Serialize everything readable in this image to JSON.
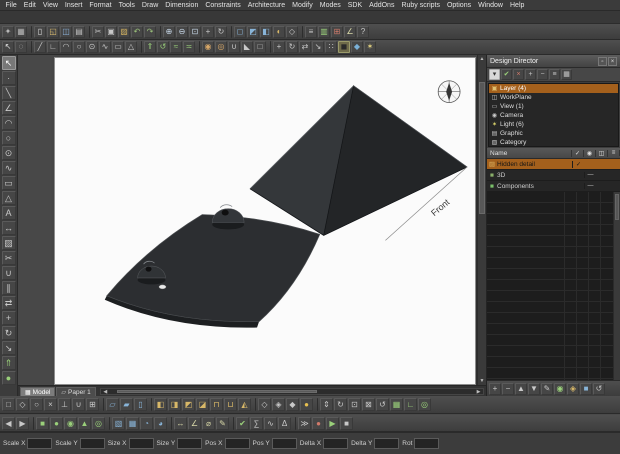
{
  "colors": {
    "selection_orange": "#a4601c",
    "paper_white": "#fbfbfb",
    "model_face_left": "#34373a",
    "model_face_right": "#232527",
    "model_plate": "#2c2e31",
    "model_edge_dark": "#1d1f21"
  },
  "icons": {
    "pin": "▫",
    "close": "×",
    "left_arrow": "◀",
    "right_arrow": "▶",
    "up_arrow": "▲",
    "down_arrow": "▼"
  },
  "menu": {
    "items": [
      "File",
      "Edit",
      "View",
      "Insert",
      "Format",
      "Tools",
      "Draw",
      "Dimension",
      "Constraints",
      "Architecture",
      "Modify",
      "Modes",
      "SDK",
      "AddOns",
      "Ruby scripts",
      "Options",
      "Window",
      "Help"
    ]
  },
  "toolbars": {
    "top1": [
      {
        "name": "settings-icon",
        "g": "✦",
        "c": "#b8b8b8"
      },
      {
        "name": "display-options-icon",
        "g": "▦",
        "c": "#b8b8b8"
      },
      {
        "name": "separator",
        "cls": "sep",
        "g": "",
        "interactable": false
      },
      {
        "name": "new-file-icon",
        "g": "▯",
        "c": "#e6e6e6"
      },
      {
        "name": "open-file-icon",
        "g": "◱",
        "c": "#e0c070"
      },
      {
        "name": "save-file-icon",
        "g": "◫",
        "c": "#8ab0d8"
      },
      {
        "name": "print-icon",
        "g": "▤",
        "c": "#c0c0c0"
      },
      {
        "name": "separator",
        "cls": "sep",
        "g": "",
        "interactable": false
      },
      {
        "name": "cut-icon",
        "g": "✂",
        "c": "#c8c8c8"
      },
      {
        "name": "copy-icon",
        "g": "▣",
        "c": "#c8c8c8"
      },
      {
        "name": "paste-icon",
        "g": "▨",
        "c": "#d0b060"
      },
      {
        "name": "undo-icon",
        "g": "↶",
        "c": "#9ac07a"
      },
      {
        "name": "redo-icon",
        "g": "↷",
        "c": "#9ac07a"
      },
      {
        "name": "separator",
        "cls": "sep",
        "g": "",
        "interactable": false
      },
      {
        "name": "zoom-in-icon",
        "g": "⊕",
        "c": "#c8d8e8"
      },
      {
        "name": "zoom-out-icon",
        "g": "⊖",
        "c": "#c8d8e8"
      },
      {
        "name": "zoom-fit-icon",
        "g": "⊡",
        "c": "#c8d8e8"
      },
      {
        "name": "pan-icon",
        "g": "+",
        "c": "#c8c8c8"
      },
      {
        "name": "rotate-view-icon",
        "g": "↻",
        "c": "#c8c8c8"
      },
      {
        "name": "separator",
        "cls": "sep",
        "g": "",
        "interactable": false
      },
      {
        "name": "front-view-icon",
        "g": "◻",
        "c": "#88b4d8"
      },
      {
        "name": "top-view-icon",
        "g": "◩",
        "c": "#88b4d8"
      },
      {
        "name": "iso-view-icon",
        "g": "◧",
        "c": "#88b4d8"
      },
      {
        "name": "shade-mode-icon",
        "g": "◐",
        "c": "#d8b868"
      },
      {
        "name": "wireframe-mode-icon",
        "g": "◇",
        "c": "#c8c8c8"
      },
      {
        "name": "separator",
        "cls": "sep",
        "g": "",
        "interactable": false
      },
      {
        "name": "layer-manager-icon",
        "g": "≡",
        "c": "#c8c8c8"
      },
      {
        "name": "design-director-icon",
        "g": "▥",
        "c": "#9ad07a"
      },
      {
        "name": "snap-grid-icon",
        "g": "⊞",
        "c": "#d07a6a"
      },
      {
        "name": "measure-icon",
        "g": "∠",
        "c": "#d8d8a8"
      },
      {
        "name": "help-icon",
        "g": "?",
        "c": "#c8c8c8"
      }
    ],
    "top2": [
      {
        "name": "select-icon",
        "g": "↖",
        "c": "#e8e8e8"
      },
      {
        "name": "lasso-select-icon",
        "g": "◌",
        "c": "#c8c8c8"
      },
      {
        "name": "separator",
        "cls": "sep",
        "g": "",
        "interactable": false
      },
      {
        "name": "line-tool-icon",
        "g": "╱",
        "c": "#c8c8c8"
      },
      {
        "name": "polyline-tool-icon",
        "g": "∟",
        "c": "#c8c8c8"
      },
      {
        "name": "arc-tool-icon",
        "g": "◠",
        "c": "#c8c8c8"
      },
      {
        "name": "circle-tool-icon",
        "g": "○",
        "c": "#c8c8c8"
      },
      {
        "name": "ellipse-tool-icon",
        "g": "⊙",
        "c": "#c8c8c8"
      },
      {
        "name": "spline-tool-icon",
        "g": "∿",
        "c": "#c8c8c8"
      },
      {
        "name": "rectangle-tool-icon",
        "g": "▭",
        "c": "#c8c8c8"
      },
      {
        "name": "polygon-tool-icon",
        "g": "△",
        "c": "#c8c8c8"
      },
      {
        "name": "separator",
        "cls": "sep",
        "g": "",
        "interactable": false
      },
      {
        "name": "extrude-icon",
        "g": "⇑",
        "c": "#9ad07a"
      },
      {
        "name": "revolve-icon",
        "g": "↺",
        "c": "#9ad07a"
      },
      {
        "name": "sweep-icon",
        "g": "≈",
        "c": "#9ad07a"
      },
      {
        "name": "loft-icon",
        "g": "≍",
        "c": "#9ad07a"
      },
      {
        "name": "separator",
        "cls": "sep",
        "g": "",
        "interactable": false
      },
      {
        "name": "boolean-union-icon",
        "g": "◉",
        "c": "#d8a868"
      },
      {
        "name": "boolean-subtract-icon",
        "g": "◎",
        "c": "#d8a868"
      },
      {
        "name": "fillet-icon",
        "g": "∪",
        "c": "#c8c8c8"
      },
      {
        "name": "chamfer-icon",
        "g": "◣",
        "c": "#c8c8c8"
      },
      {
        "name": "shell-icon",
        "g": "□",
        "c": "#c8c8c8"
      },
      {
        "name": "separator",
        "cls": "sep",
        "g": "",
        "interactable": false
      },
      {
        "name": "move-icon",
        "g": "+",
        "c": "#c8c8c8"
      },
      {
        "name": "rotate-icon",
        "g": "↻",
        "c": "#c8c8c8"
      },
      {
        "name": "mirror-icon",
        "g": "⇄",
        "c": "#c8c8c8"
      },
      {
        "name": "scale-tool-icon",
        "g": "↘",
        "c": "#c8c8c8"
      },
      {
        "name": "array-icon",
        "g": "∷",
        "c": "#c8c8c8"
      },
      {
        "name": "render-icon",
        "g": "◼",
        "c": "#2a2a2a",
        "active": true
      },
      {
        "name": "materials-icon",
        "g": "◆",
        "c": "#7ab0d8"
      },
      {
        "name": "lights-icon",
        "g": "✶",
        "c": "#e0d080"
      }
    ],
    "left": [
      {
        "name": "select-arrow-icon",
        "g": "↖",
        "c": "#ffffff",
        "active": true
      },
      {
        "name": "point-tool-icon",
        "g": "∙",
        "c": "#c8c8c8"
      },
      {
        "name": "line-tool-icon",
        "g": "╲",
        "c": "#c8c8c8"
      },
      {
        "name": "polyline-tool-icon",
        "g": "∠",
        "c": "#c8c8c8"
      },
      {
        "name": "arc-tool-icon",
        "g": "◠",
        "c": "#c8c8c8"
      },
      {
        "name": "circle-tool-icon",
        "g": "○",
        "c": "#c8c8c8"
      },
      {
        "name": "ellipse-tool-icon",
        "g": "⊙",
        "c": "#c8c8c8"
      },
      {
        "name": "spline-tool-icon",
        "g": "∿",
        "c": "#c8c8c8"
      },
      {
        "name": "rectangle-tool-icon",
        "g": "▭",
        "c": "#c8c8c8"
      },
      {
        "name": "polygon-tool-icon",
        "g": "△",
        "c": "#c8c8c8"
      },
      {
        "name": "text-tool-icon",
        "g": "A",
        "c": "#c8c8c8"
      },
      {
        "name": "dimension-tool-icon",
        "g": "↔",
        "c": "#c8c8c8"
      },
      {
        "name": "hatch-tool-icon",
        "g": "▨",
        "c": "#c8c8c8"
      },
      {
        "name": "trim-tool-icon",
        "g": "✂",
        "c": "#c8c8c8"
      },
      {
        "name": "fillet-tool-icon",
        "g": "∪",
        "c": "#c8c8c8"
      },
      {
        "name": "offset-tool-icon",
        "g": "∥",
        "c": "#c8c8c8"
      },
      {
        "name": "mirror-tool-icon",
        "g": "⇄",
        "c": "#c8c8c8"
      },
      {
        "name": "move-tool-icon",
        "g": "+",
        "c": "#c8c8c8"
      },
      {
        "name": "rotate-tool-icon",
        "g": "↻",
        "c": "#c8c8c8"
      },
      {
        "name": "scale-tool-icon",
        "g": "↘",
        "c": "#c8c8c8"
      },
      {
        "name": "extrude-tool-icon",
        "g": "⇑",
        "c": "#9ad07a"
      },
      {
        "name": "sphere-tool-icon",
        "g": "●",
        "c": "#9ad07a"
      }
    ],
    "bottom1": [
      {
        "name": "snap-endpoint-icon",
        "g": "□",
        "c": "#c8c8c8"
      },
      {
        "name": "snap-midpoint-icon",
        "g": "◇",
        "c": "#c8c8c8"
      },
      {
        "name": "snap-center-icon",
        "g": "○",
        "c": "#c8c8c8"
      },
      {
        "name": "snap-intersection-icon",
        "g": "×",
        "c": "#c8c8c8"
      },
      {
        "name": "snap-perpendicular-icon",
        "g": "⊥",
        "c": "#c8c8c8"
      },
      {
        "name": "snap-tangent-icon",
        "g": "∪",
        "c": "#c8c8c8"
      },
      {
        "name": "snap-grid-icon",
        "g": "⊞",
        "c": "#c8c8c8"
      },
      {
        "name": "separator",
        "cls": "sep",
        "g": "",
        "interactable": false
      },
      {
        "name": "plane-xy-icon",
        "g": "▱",
        "c": "#88b4d8"
      },
      {
        "name": "plane-yz-icon",
        "g": "▰",
        "c": "#88b4d8"
      },
      {
        "name": "plane-zx-icon",
        "g": "▯",
        "c": "#88b4d8"
      },
      {
        "name": "separator",
        "cls": "sep",
        "g": "",
        "interactable": false
      },
      {
        "name": "view-front-icon",
        "g": "◧",
        "c": "#d8b868"
      },
      {
        "name": "view-back-icon",
        "g": "◨",
        "c": "#d8b868"
      },
      {
        "name": "view-left-icon",
        "g": "◩",
        "c": "#d8b868"
      },
      {
        "name": "view-right-icon",
        "g": "◪",
        "c": "#d8b868"
      },
      {
        "name": "view-top-icon",
        "g": "⊓",
        "c": "#d8b868"
      },
      {
        "name": "view-bottom-icon",
        "g": "⊔",
        "c": "#d8b868"
      },
      {
        "name": "view-iso-icon",
        "g": "◭",
        "c": "#d8b868"
      },
      {
        "name": "separator",
        "cls": "sep",
        "g": "",
        "interactable": false
      },
      {
        "name": "wireframe-icon",
        "g": "◇",
        "c": "#c8c8c8"
      },
      {
        "name": "hidden-line-icon",
        "g": "◈",
        "c": "#c8c8c8"
      },
      {
        "name": "shaded-icon",
        "g": "◆",
        "c": "#c8c8c8"
      },
      {
        "name": "rendered-icon",
        "g": "●",
        "c": "#e8c050"
      },
      {
        "name": "separator",
        "cls": "sep",
        "g": "",
        "interactable": false
      },
      {
        "name": "walk-icon",
        "g": "⇕",
        "c": "#c8c8c8"
      },
      {
        "name": "orbit-icon",
        "g": "↻",
        "c": "#c8c8c8"
      },
      {
        "name": "zoom-window-icon",
        "g": "⊡",
        "c": "#c8c8c8"
      },
      {
        "name": "zoom-all-icon",
        "g": "⊠",
        "c": "#c8c8c8"
      },
      {
        "name": "redraw-icon",
        "g": "↺",
        "c": "#c8c8c8"
      },
      {
        "name": "grid-toggle-icon",
        "g": "▦",
        "c": "#9ad07a"
      },
      {
        "name": "ortho-toggle-icon",
        "g": "∟",
        "c": "#9ad07a"
      },
      {
        "name": "osnap-toggle-icon",
        "g": "◎",
        "c": "#9ad07a"
      }
    ],
    "bottom2": [
      {
        "name": "layer-prev-icon",
        "g": "◀",
        "c": "#c8c8c8"
      },
      {
        "name": "layer-next-icon",
        "g": "▶",
        "c": "#c8c8c8"
      },
      {
        "name": "separator",
        "cls": "sep",
        "g": "",
        "interactable": false
      },
      {
        "name": "solid-box-icon",
        "g": "■",
        "c": "#9ad07a"
      },
      {
        "name": "solid-sphere-icon",
        "g": "●",
        "c": "#9ad07a"
      },
      {
        "name": "solid-cylinder-icon",
        "g": "◉",
        "c": "#9ad07a"
      },
      {
        "name": "solid-cone-icon",
        "g": "▲",
        "c": "#9ad07a"
      },
      {
        "name": "solid-torus-icon",
        "g": "◎",
        "c": "#9ad07a"
      },
      {
        "name": "separator",
        "cls": "sep",
        "g": "",
        "interactable": false
      },
      {
        "name": "surface-patch-icon",
        "g": "▧",
        "c": "#88b4d8"
      },
      {
        "name": "surface-net-icon",
        "g": "▦",
        "c": "#88b4d8"
      },
      {
        "name": "surface-revolve-icon",
        "g": "◔",
        "c": "#88b4d8"
      },
      {
        "name": "surface-sweep-icon",
        "g": "◕",
        "c": "#88b4d8"
      },
      {
        "name": "separator",
        "cls": "sep",
        "g": "",
        "interactable": false
      },
      {
        "name": "dim-linear-icon",
        "g": "↔",
        "c": "#d8d8a8"
      },
      {
        "name": "dim-angular-icon",
        "g": "∠",
        "c": "#d8d8a8"
      },
      {
        "name": "dim-radius-icon",
        "g": "⌀",
        "c": "#d8d8a8"
      },
      {
        "name": "dim-note-icon",
        "g": "✎",
        "c": "#d8d8a8"
      },
      {
        "name": "separator",
        "cls": "sep",
        "g": "",
        "interactable": false
      },
      {
        "name": "check-geometry-icon",
        "g": "✔",
        "c": "#9ad07a"
      },
      {
        "name": "analysis-icon",
        "g": "∑",
        "c": "#c8c8c8"
      },
      {
        "name": "curvature-icon",
        "g": "∿",
        "c": "#c8c8c8"
      },
      {
        "name": "mass-props-icon",
        "g": "Δ",
        "c": "#c8c8c8"
      },
      {
        "name": "separator",
        "cls": "sep",
        "g": "",
        "interactable": false
      },
      {
        "name": "script-console-icon",
        "g": "≫",
        "c": "#c8c8c8"
      },
      {
        "name": "macro-record-icon",
        "g": "●",
        "c": "#d07a6a"
      },
      {
        "name": "macro-play-icon",
        "g": "▶",
        "c": "#9ad07a"
      },
      {
        "name": "macro-stop-icon",
        "g": "■",
        "c": "#c8c8c8"
      }
    ]
  },
  "design_director": {
    "title": "Design Director",
    "toolbar": [
      {
        "name": "dd-filter-icon",
        "g": "▾",
        "c": "#333333",
        "cls": "lit"
      },
      {
        "name": "dd-show-all-icon",
        "g": "✔",
        "c": "#9ad07a"
      },
      {
        "name": "dd-hide-all-icon",
        "g": "×",
        "c": "#d07a6a"
      },
      {
        "name": "dd-new-layer-icon",
        "g": "+",
        "c": "#c8c8c8"
      },
      {
        "name": "dd-delete-layer-icon",
        "g": "−",
        "c": "#c8c8c8"
      },
      {
        "name": "dd-sort-icon",
        "g": "≡",
        "c": "#c8c8c8"
      },
      {
        "name": "dd-columns-icon",
        "g": "▦",
        "c": "#c8c8c8"
      }
    ],
    "tree": [
      {
        "name": "tree-item-layer",
        "icon": "▣",
        "icon_c": "#e0c070",
        "label": "Layer (4)",
        "active": true
      },
      {
        "name": "tree-item-workplane",
        "icon": "◫",
        "icon_c": "#c8c8c8",
        "label": "WorkPlane"
      },
      {
        "name": "tree-item-view",
        "icon": "▭",
        "icon_c": "#c8c8c8",
        "label": "View (1)"
      },
      {
        "name": "tree-item-camera",
        "icon": "◉",
        "icon_c": "#c8c8c8",
        "label": "Camera"
      },
      {
        "name": "tree-item-light",
        "icon": "✶",
        "icon_c": "#e8e070",
        "label": "Light (6)"
      },
      {
        "name": "tree-item-graphic",
        "icon": "▤",
        "icon_c": "#c8c8c8",
        "label": "Graphic"
      },
      {
        "name": "tree-item-category",
        "icon": "▧",
        "icon_c": "#c8c8c8",
        "label": "Category"
      }
    ],
    "table": {
      "header": {
        "name_label": "Name",
        "c1": "✓",
        "c2": "◉",
        "c3": "◫",
        "c4": "≡"
      },
      "rows": [
        {
          "name": "layer-row-hidden-detail",
          "icon": "▨",
          "icon_c": "#d8b060",
          "label": "Hidden detail",
          "m1": "✓",
          "m2": "",
          "m3": "",
          "m4": "",
          "active": true
        },
        {
          "name": "layer-row-3d",
          "icon": "■",
          "icon_c": "#8ab06a",
          "label": "3D",
          "m1": "",
          "m2": "—",
          "m3": "",
          "m4": ""
        },
        {
          "name": "layer-row-components",
          "icon": "■",
          "icon_c": "#7ac06a",
          "label": "Components",
          "m1": "",
          "m2": "—",
          "m3": "",
          "m4": ""
        }
      ]
    },
    "bottom_toolbar": [
      {
        "name": "dd-add-icon",
        "g": "+",
        "c": "#c8c8c8"
      },
      {
        "name": "dd-remove-icon",
        "g": "−",
        "c": "#c8c8c8"
      },
      {
        "name": "dd-up-icon",
        "g": "▲",
        "c": "#c8c8c8"
      },
      {
        "name": "dd-down-icon",
        "g": "▼",
        "c": "#c8c8c8"
      },
      {
        "name": "dd-edit-icon",
        "g": "✎",
        "c": "#c8c8c8"
      },
      {
        "name": "dd-visible-icon",
        "g": "◉",
        "c": "#9ad07a"
      },
      {
        "name": "dd-lock-icon",
        "g": "◈",
        "c": "#d8b868"
      },
      {
        "name": "dd-color-icon",
        "g": "■",
        "c": "#88b4d8"
      },
      {
        "name": "dd-refresh-icon",
        "g": "↺",
        "c": "#c8c8c8"
      }
    ]
  },
  "canvas": {
    "front_label": "Front"
  },
  "sheet_tabs": [
    {
      "name": "tab-model",
      "icon": "▦",
      "label": "Model",
      "active": true
    },
    {
      "name": "tab-paper-1",
      "icon": "▱",
      "label": "Paper 1"
    }
  ],
  "status_bar": {
    "fields": [
      {
        "label": "Scale X",
        "value": ""
      },
      {
        "label": "Scale Y",
        "value": ""
      },
      {
        "label": "Size X",
        "value": ""
      },
      {
        "label": "Size Y",
        "value": ""
      },
      {
        "label": "Pos X",
        "value": ""
      },
      {
        "label": "Pos Y",
        "value": ""
      },
      {
        "label": "Delta X",
        "value": ""
      },
      {
        "label": "Delta Y",
        "value": ""
      },
      {
        "label": "Rot",
        "value": ""
      }
    ]
  }
}
